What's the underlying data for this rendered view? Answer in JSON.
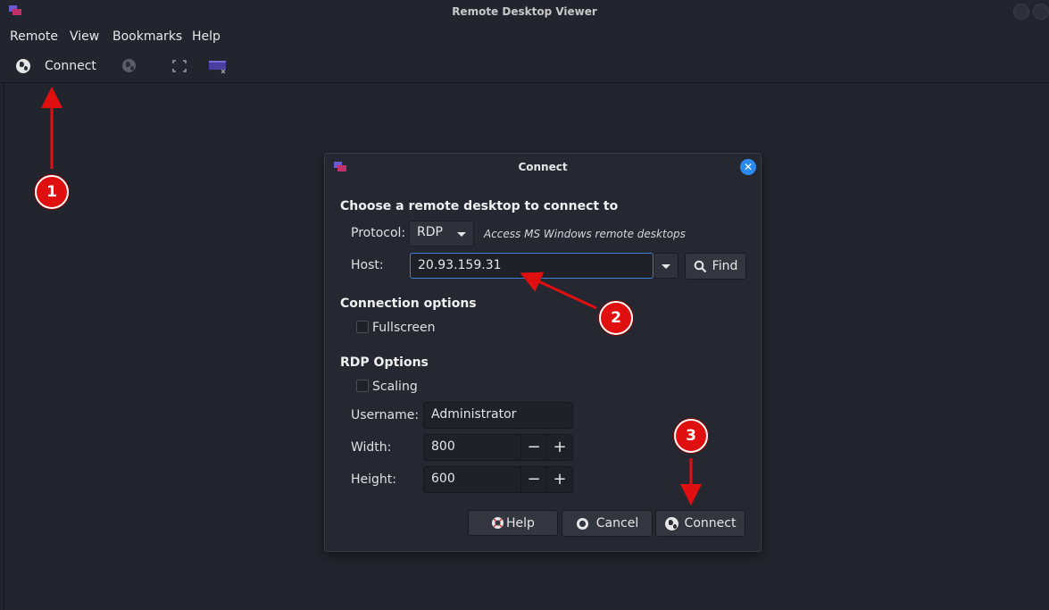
{
  "window": {
    "title": "Remote Desktop Viewer"
  },
  "menubar": {
    "items": [
      "Remote",
      "View",
      "Bookmarks",
      "Help"
    ]
  },
  "toolbar": {
    "connect_label": "Connect"
  },
  "dialog": {
    "title": "Connect",
    "section_choose": "Choose a remote desktop to connect to",
    "protocol_label": "Protocol:",
    "protocol_value": "RDP",
    "protocol_description": "Access MS Windows remote desktops",
    "host_label": "Host:",
    "host_value": "20.93.159.31",
    "find_label": "Find",
    "section_connection": "Connection options",
    "fullscreen_label": "Fullscreen",
    "section_rdp": "RDP Options",
    "scaling_label": "Scaling",
    "username_label": "Username:",
    "username_value": "Administrator",
    "width_label": "Width:",
    "width_value": "800",
    "height_label": "Height:",
    "height_value": "600",
    "help_label": "Help",
    "cancel_label": "Cancel",
    "connect_label": "Connect"
  },
  "annotations": {
    "step1": "1",
    "step2": "2",
    "step3": "3"
  },
  "colors": {
    "marker": "#e01010",
    "accent": "#2a8af0",
    "background": "#23252e"
  },
  "icons": [
    "app-icon",
    "globe-icon",
    "fullscreen-icon",
    "screenshot-icon",
    "close-icon",
    "search-icon",
    "help-icon",
    "cancel-icon"
  ]
}
